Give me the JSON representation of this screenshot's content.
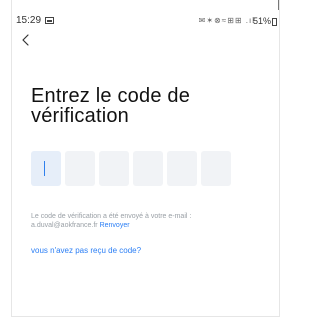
{
  "status_bar": {
    "time": "15:29",
    "system_icons": "✉✶⊗≈⊞⊞ .ıl",
    "battery": "51%"
  },
  "header": {
    "back_icon": "chevron-left-icon"
  },
  "main": {
    "title": "Entrez le code de vérification",
    "code_length": 6,
    "sent_prefix": "Le code de vérification a été envoyé à votre e-mail :",
    "email": "a.duval@aokfrance.fr",
    "resend": "Renvoyer",
    "no_code": "vous n'avez pas reçu de code?"
  },
  "colors": {
    "link": "#2a7ef5",
    "active_box": "#e6eef9",
    "box": "#f1f3f6",
    "cursor": "#2f80ed"
  }
}
